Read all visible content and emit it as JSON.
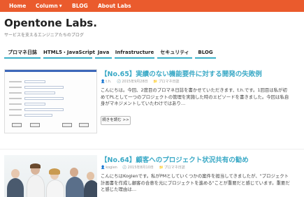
{
  "topnav": {
    "items": [
      "Home",
      "Column",
      "BLOG",
      "About Labs"
    ],
    "bg": "#ea5b2d"
  },
  "brand": {
    "title": "Opentone Labs.",
    "subtitle": "サービスを支えるエンジニアたちのブログ"
  },
  "categories": [
    "プロマネ日誌",
    "HTML5・JavaScript",
    "Java",
    "Infrastructure",
    "セキュリティ",
    "BLOG"
  ],
  "accent": "#3ab0c8",
  "posts": [
    {
      "title": "【No.65】実績のない機能要件に対する開発の失敗例",
      "author": "t.h.",
      "date": "2015年9月28日",
      "category": "プロマネ日誌",
      "excerpt": [
        "こんにちは。今回、2度目のプロマネ日誌を書かせていただきます、t.h.です。1回目は私が初",
        "めてPLとして一つのプロジェクトの管理を実施した時のエピソードを書きました。今回は私自",
        "身がマネジメントしていたわけではあり…"
      ],
      "read_more": "続きを読む >>"
    },
    {
      "title": "【No.64】顧客へのプロジェクト状況共有の勧め",
      "author": "kogien",
      "date": "2015年8月10日",
      "category": "プロマネ日誌",
      "excerpt": [
        "こんにちはKoglenです。私がPMとしていくつかの案件を担当してきましたが、\"プロジェクト",
        "計画書を作成し顧客の合意を元にプロジェクトを進める\"ことが重要だと感じています。重要だ",
        "と感じた理由は…"
      ]
    }
  ]
}
